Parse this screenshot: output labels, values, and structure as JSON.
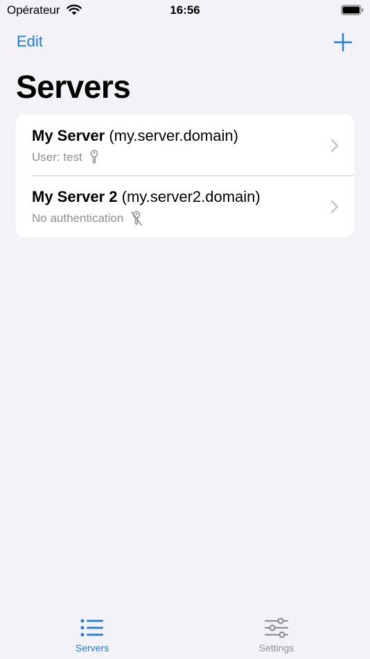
{
  "status_bar": {
    "carrier": "Opérateur",
    "time": "16:56"
  },
  "nav": {
    "edit_label": "Edit",
    "title": "Servers"
  },
  "servers": [
    {
      "name": "My Server",
      "host": "(my.server.domain)",
      "subtitle": "User: test",
      "icon": "key-icon"
    },
    {
      "name": "My Server 2",
      "host": "(my.server2.domain)",
      "subtitle": "No authentication",
      "icon": "key-slash-icon"
    }
  ],
  "tabs": [
    {
      "label": "Servers",
      "icon": "list-icon",
      "active": true
    },
    {
      "label": "Settings",
      "icon": "sliders-icon",
      "active": false
    }
  ],
  "colors": {
    "accent": "#1f7ae0",
    "background": "#f2f2f7",
    "secondary_text": "#8e8e93"
  }
}
